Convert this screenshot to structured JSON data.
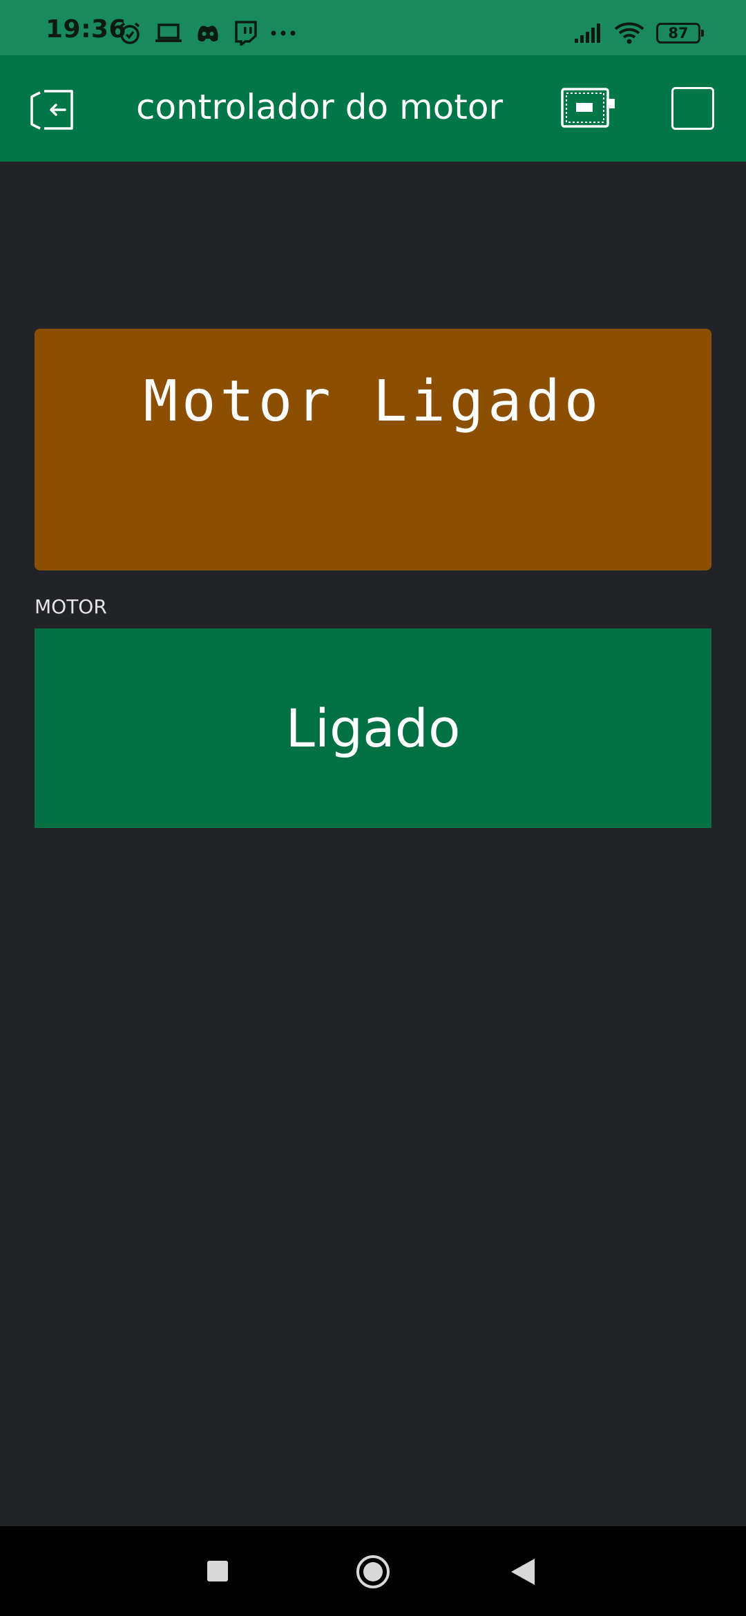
{
  "status_bar": {
    "time": "19:36",
    "battery_level": "87",
    "left_icons": [
      "alarm-icon",
      "laptop-icon",
      "discord-icon",
      "twitch-icon",
      "more-icon"
    ],
    "right_icons": [
      "signal-icon",
      "wifi-icon",
      "battery-icon"
    ]
  },
  "app_bar": {
    "title": "controlador do motor",
    "exit_icon": "exit-icon",
    "device_icon": "device-icon",
    "square_icon": "stop-icon"
  },
  "lcd": {
    "line1": "Motor Ligado",
    "line2": "",
    "background": "#8c4f01",
    "text_color": "#ffffff"
  },
  "motor_button": {
    "label": "MOTOR",
    "state_text": "Ligado",
    "background": "#017144"
  },
  "colors": {
    "status_bar": "#188a5e",
    "app_bar": "#017748",
    "background": "#222327",
    "nav_bar": "#000000"
  },
  "nav_bar": {
    "icons": [
      "recents-icon",
      "home-icon",
      "back-icon"
    ]
  }
}
